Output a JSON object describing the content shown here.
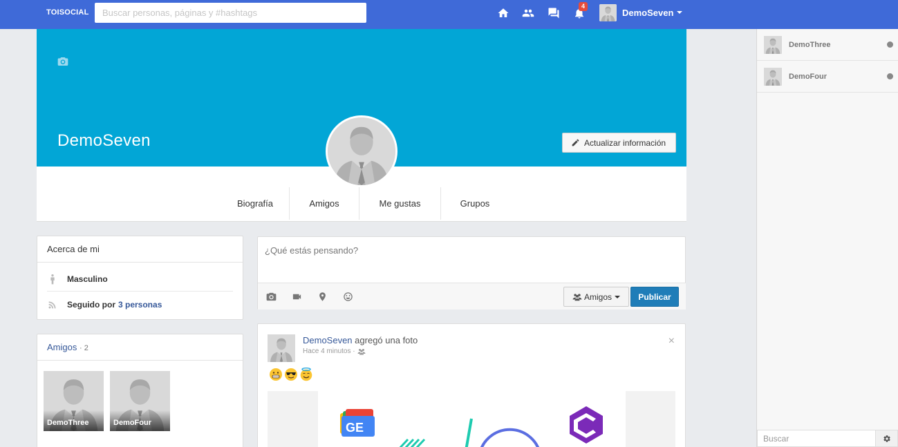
{
  "navbar": {
    "brand": "TOISOCIAL",
    "search_placeholder": "Buscar personas, páginas y #hashtags",
    "notifications_count": "4",
    "user_name": "DemoSeven"
  },
  "chat": {
    "contacts": [
      {
        "name": "DemoThree"
      },
      {
        "name": "DemoFour"
      }
    ],
    "search_placeholder": "Buscar"
  },
  "profile": {
    "name": "DemoSeven",
    "update_button": "Actualizar información",
    "tabs": [
      "Biografía",
      "Amigos",
      "Me gustas",
      "Grupos"
    ]
  },
  "about": {
    "title": "Acerca de mi",
    "gender": "Masculino",
    "followed_prefix": "Seguido por",
    "followed_link": "3 personas"
  },
  "friends": {
    "title": "Amigos",
    "count": "· 2",
    "items": [
      {
        "name": "DemoThree"
      },
      {
        "name": "DemoFour"
      }
    ]
  },
  "composer": {
    "placeholder": "¿Qué estás pensando?",
    "audience": "Amigos",
    "publish": "Publicar"
  },
  "post": {
    "author": "DemoSeven",
    "action": "agregó una foto",
    "time": "Hace 4 minutos ·",
    "close": "×"
  }
}
